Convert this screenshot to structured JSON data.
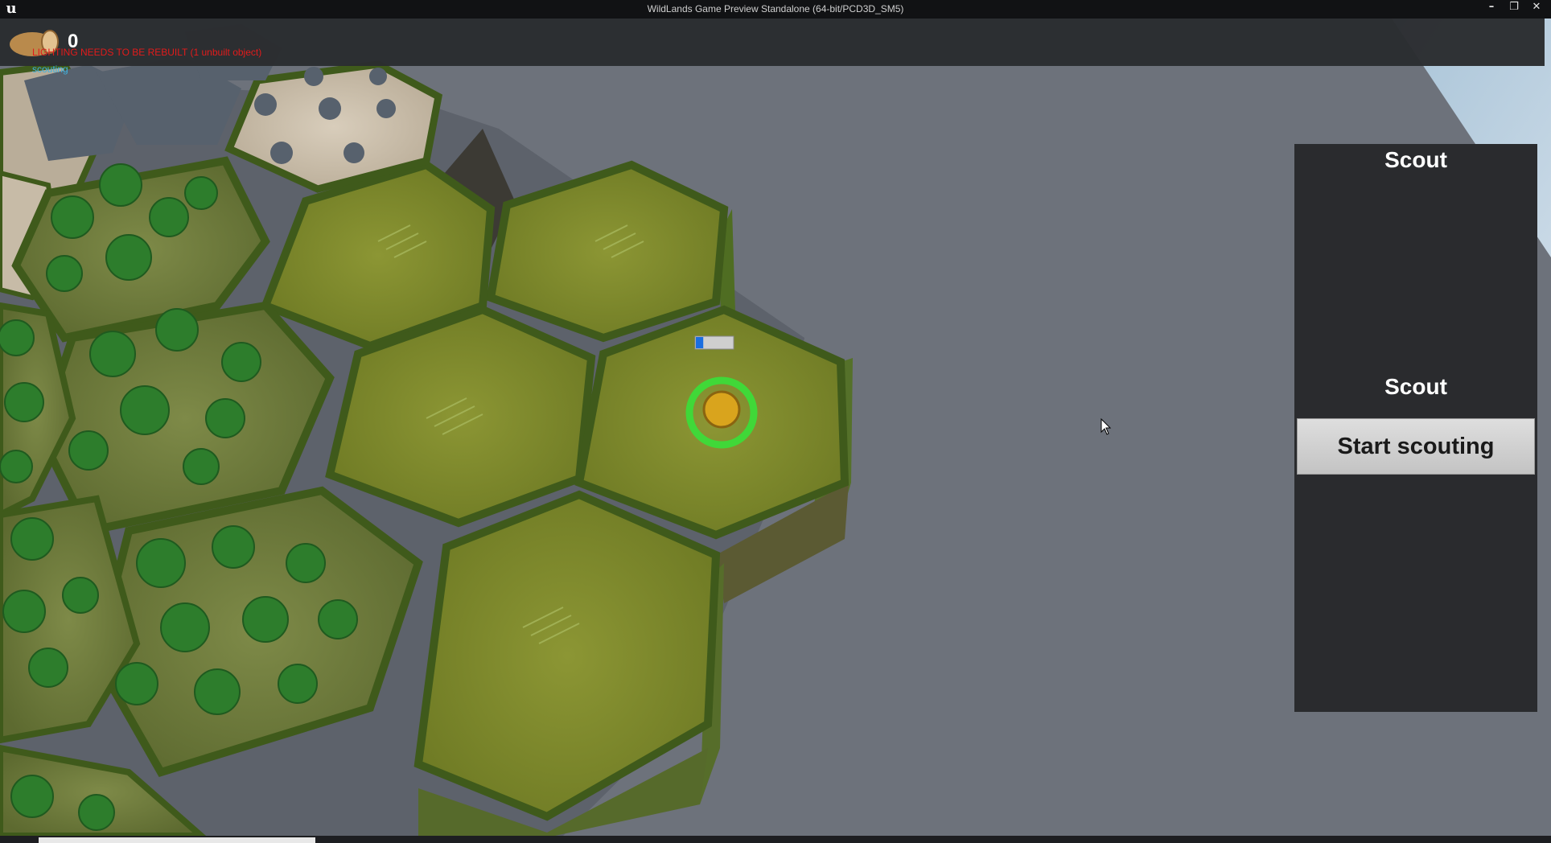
{
  "window": {
    "title": "WildLands Game Preview Standalone (64-bit/PCD3D_SM5)",
    "buttons": [
      "minimize",
      "restore",
      "close"
    ]
  },
  "hud": {
    "resource_icon": "wood-log-icon",
    "resource_count": "0",
    "warning": "LIGHTING NEEDS TO BE REBUILT (1 unbuilt object)",
    "status": "scouting",
    "warning_color": "#e21b1b",
    "status_color": "#3fb3e0"
  },
  "unit": {
    "progress_fraction": 0.2,
    "selection_color": "#38e03a"
  },
  "panel": {
    "title": "Scout",
    "action_label": "Scout",
    "button_label": "Start scouting"
  },
  "colors": {
    "panel_bg": "#2a2b2e",
    "ground": "#6c717a",
    "grass": "#7f8a2a",
    "forest": "#2f7a2a",
    "rock": "#cfc3b0"
  }
}
